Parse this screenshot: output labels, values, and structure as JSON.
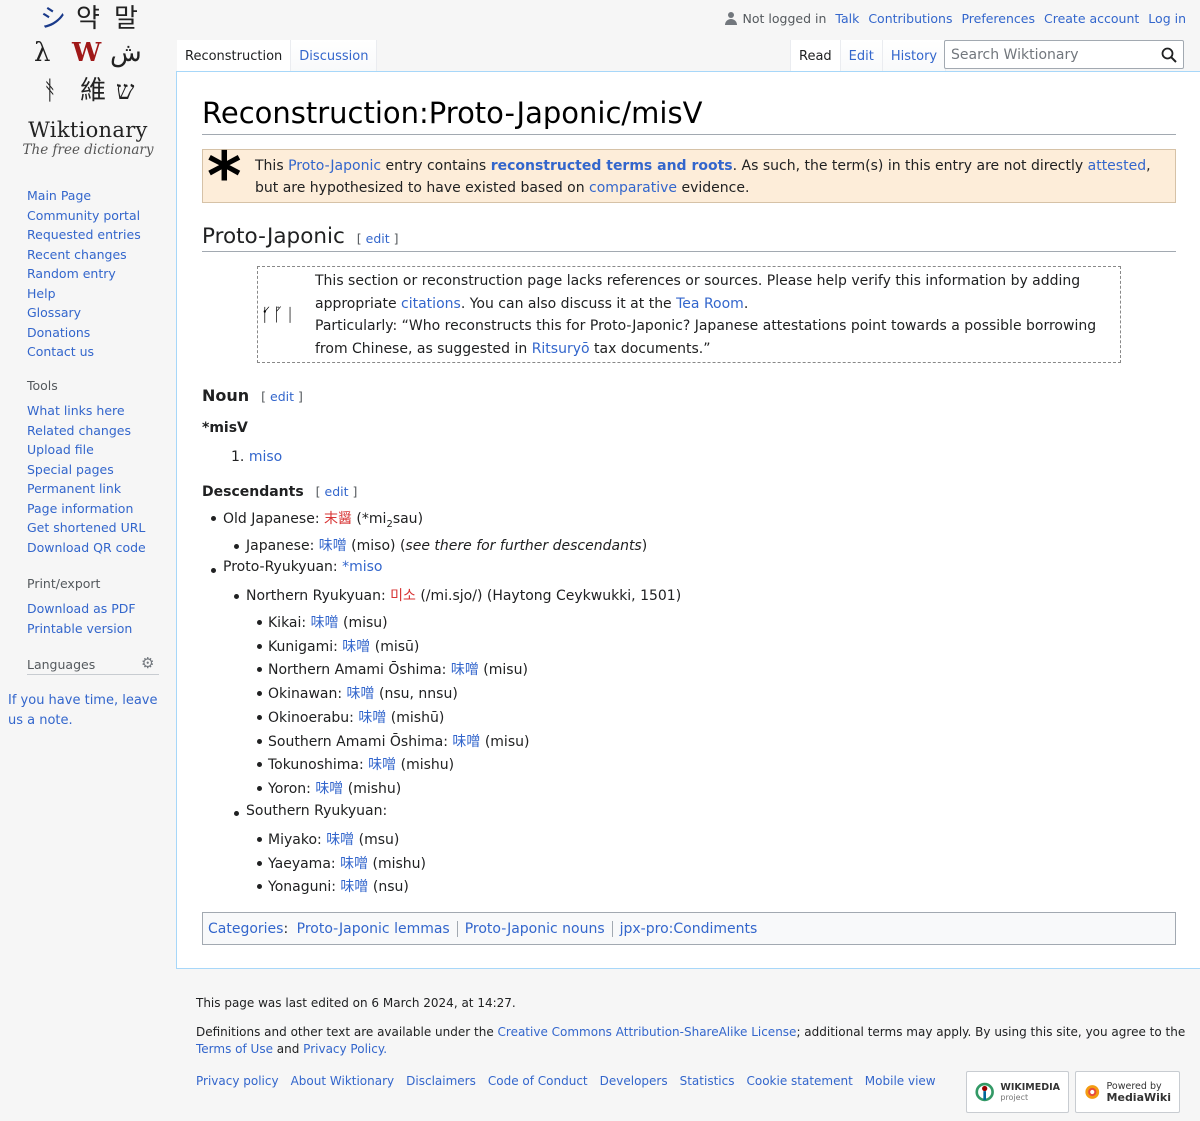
{
  "logo": {
    "wordmark": "Wiktionary",
    "tagline": "The free dictionary"
  },
  "sidebar": {
    "navigation": [
      "Main Page",
      "Community portal",
      "Requested entries",
      "Recent changes",
      "Random entry",
      "Help",
      "Glossary",
      "Donations",
      "Contact us"
    ],
    "tools_heading": "Tools",
    "tools": [
      "What links here",
      "Related changes",
      "Upload file",
      "Special pages",
      "Permanent link",
      "Page information",
      "Get shortened URL",
      "Download QR code"
    ],
    "print_heading": "Print/export",
    "print": [
      "Download as PDF",
      "Printable version"
    ],
    "languages_heading": "Languages",
    "languages_note": "If you have time, leave us a note."
  },
  "personal": {
    "not_logged_in": "Not logged in",
    "links": [
      "Talk",
      "Contributions",
      "Preferences",
      "Create account",
      "Log in"
    ]
  },
  "tabs_left": [
    "Reconstruction",
    "Discussion"
  ],
  "tabs_right": [
    "Read",
    "Edit",
    "History"
  ],
  "search": {
    "placeholder": "Search Wiktionary"
  },
  "page": {
    "title": "Reconstruction:Proto-Japonic/misV",
    "recon_notice": {
      "t1": "This ",
      "l1": "Proto-Japonic",
      "t2": " entry contains ",
      "l2": "reconstructed terms and roots",
      "t3": ". As such, the term(s) in this entry are not directly ",
      "l3": "attested",
      "t4": ", but are hypothesized to have existed based on ",
      "l4": "comparative",
      "t5": " evidence."
    },
    "section_heading": "Proto-Japonic",
    "edit_label": "edit",
    "ref_notice": {
      "icon": "ᚶᚵᛁ",
      "t1": "This section or reconstruction page lacks references or sources. Please help verify this information by adding appropriate ",
      "l1": "citations",
      "t2": ". You can also discuss it at the ",
      "l2": "Tea Room",
      "t3": ".",
      "t4": "Particularly: “Who reconstructs this for Proto-Japonic? Japanese attestations point towards a possible borrowing from Chinese, as suggested in ",
      "l3": "Ritsuryō",
      "t5": " tax documents.”"
    },
    "noun_heading": "Noun",
    "headword": "*misV",
    "sense_num": "1.",
    "sense": "miso",
    "descendants_heading": "Descendants",
    "descendants": {
      "oj_label": "Old Japanese: ",
      "oj_word": "末醤",
      "oj_rom": "*mi",
      "oj_sub": "2",
      "oj_rom2": "sau",
      "jp_label": "Japanese: ",
      "jp_word": "味噌",
      "jp_rom": " (miso) (",
      "jp_note": "see there for further descendants",
      "jp_close": ")",
      "pr_label": "Proto-Ryukyuan: ",
      "pr_word": "*miso",
      "nr_label": "Northern Ryukyuan: ",
      "nr_word": "미소",
      "nr_rest": " (/mi.sjo/) (Haytong Ceykwukki, 1501)",
      "northern": [
        {
          "label": "Kikai: ",
          "word": "味噌",
          "rom": " (misu)"
        },
        {
          "label": "Kunigami: ",
          "word": "味噌",
          "rom": " (misū)"
        },
        {
          "label": "Northern Amami Ōshima: ",
          "word": "味噌",
          "rom": " (misu)"
        },
        {
          "label": "Okinawan: ",
          "word": "味噌",
          "rom": " (nsu, nnsu)"
        },
        {
          "label": "Okinoerabu: ",
          "word": "味噌",
          "rom": " (mishū)"
        },
        {
          "label": "Southern Amami Ōshima: ",
          "word": "味噌",
          "rom": " (misu)"
        },
        {
          "label": "Tokunoshima: ",
          "word": "味噌",
          "rom": " (mishu)"
        },
        {
          "label": "Yoron: ",
          "word": "味噌",
          "rom": " (mishu)"
        }
      ],
      "sr_label": "Southern Ryukyuan:",
      "southern": [
        {
          "label": "Miyako: ",
          "word": "味噌",
          "rom": " (msu)"
        },
        {
          "label": "Yaeyama: ",
          "word": "味噌",
          "rom": " (mishu)"
        },
        {
          "label": "Yonaguni: ",
          "word": "味噌",
          "rom": " (nsu)"
        }
      ]
    },
    "categories_label": "Categories",
    "categories": [
      "Proto-Japonic lemmas",
      "Proto-Japonic nouns",
      "jpx-pro:Condiments"
    ]
  },
  "footer": {
    "last_edited": "This page was last edited on 6 March 2024, at 14:27.",
    "license_t1": "Definitions and other text are available under the ",
    "license_l1": "Creative Commons Attribution-ShareAlike License",
    "license_t2": "; additional terms may apply. By using this site, you agree to the ",
    "license_l2": "Terms of Use",
    "license_t3": " and ",
    "license_l3": "Privacy Policy.",
    "links": [
      "Privacy policy",
      "About Wiktionary",
      "Disclaimers",
      "Code of Conduct",
      "Developers",
      "Statistics",
      "Cookie statement",
      "Mobile view"
    ],
    "wikimedia_badge": "WIKIMEDIA",
    "wikimedia_sub": "project",
    "mediawiki_badge_1": "Powered by",
    "mediawiki_badge_2": "MediaWiki"
  },
  "colors": {
    "link": "#3366cc",
    "redlink": "#d73333",
    "notice_bg": "#fdedd9",
    "content_border": "#a7d7f9"
  }
}
